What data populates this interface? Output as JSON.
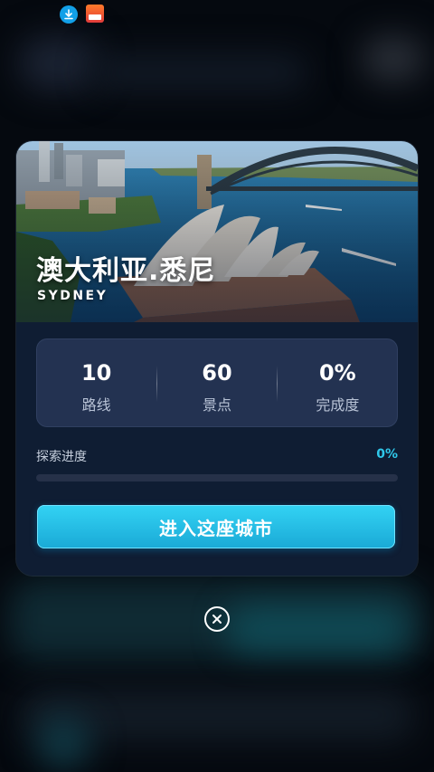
{
  "status_bar": {
    "icons": [
      "download-icon",
      "app-notification-icon"
    ]
  },
  "card": {
    "title": "澳大利亚.悉尼",
    "subtitle": "SYDNEY",
    "stats": [
      {
        "value": "10",
        "label": "路线"
      },
      {
        "value": "60",
        "label": "景点"
      },
      {
        "value": "0%",
        "label": "完成度"
      }
    ],
    "progress": {
      "label": "探索进度",
      "value_text": "0%",
      "fraction": 0
    },
    "enter_button_label": "进入这座城市"
  },
  "close_icon": "close-circle-icon",
  "colors": {
    "accent": "#2fc8ea",
    "card_bg": "#0f1d33",
    "stats_bg": "#233251",
    "button_top": "#33d3f4",
    "button_bottom": "#1aa9d6"
  }
}
